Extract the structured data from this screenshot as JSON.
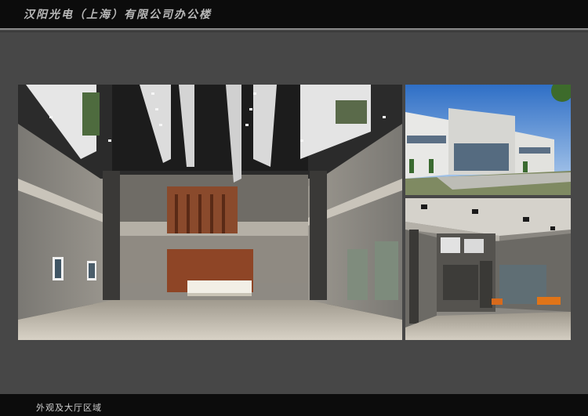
{
  "header": {
    "title": "汉阳光电（上海）有限公司办公楼"
  },
  "footer": {
    "caption": "外观及大厅区域"
  }
}
